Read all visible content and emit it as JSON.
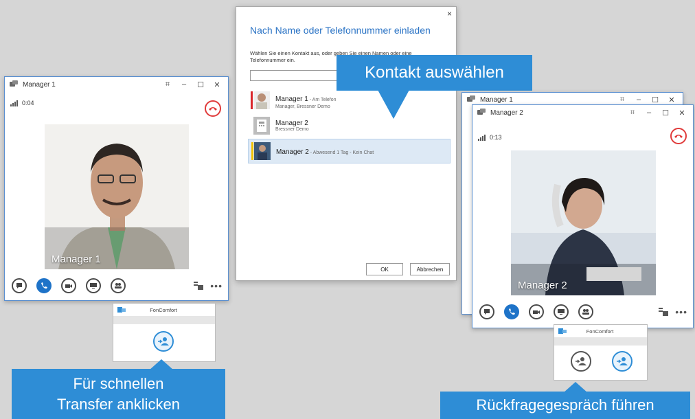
{
  "left_window": {
    "title": "Manager 1",
    "duration": "0:04",
    "video_label": "Manager 1"
  },
  "back_window": {
    "title": "Manager 1"
  },
  "right_window": {
    "title": "Manager 2",
    "duration": "0:13",
    "video_label": "Manager 2"
  },
  "dialog": {
    "close": "×",
    "title": "Nach Name oder Telefonnummer einladen",
    "description": "Wählen Sie einen Kontakt aus, oder geben Sie einen Namen oder eine Telefonnummer ein.",
    "contacts": [
      {
        "name": "Manager 1",
        "note": " - Am Telefon",
        "sub": "Manager, Bressner Demo"
      },
      {
        "name": "Manager 2",
        "note": "",
        "sub": "Bressner Demo"
      },
      {
        "name": "Manager 2",
        "note": " - Abwesend 1 Tag - Kein Chat",
        "sub": ""
      }
    ],
    "ok_label": "OK",
    "cancel_label": "Abbrechen"
  },
  "callouts": {
    "select": "Kontakt auswählen",
    "transfer_line1": "Für schnellen",
    "transfer_line2": "Transfer anklicken",
    "consult": "Rückfragegespräch führen"
  },
  "foncomfort": {
    "brand": "FonComfort"
  },
  "colors": {
    "accent_blue": "#2e8dd6",
    "title_blue": "#2a73c5",
    "hangup_red": "#e03a3a",
    "active_call_blue": "#1e73c8"
  }
}
